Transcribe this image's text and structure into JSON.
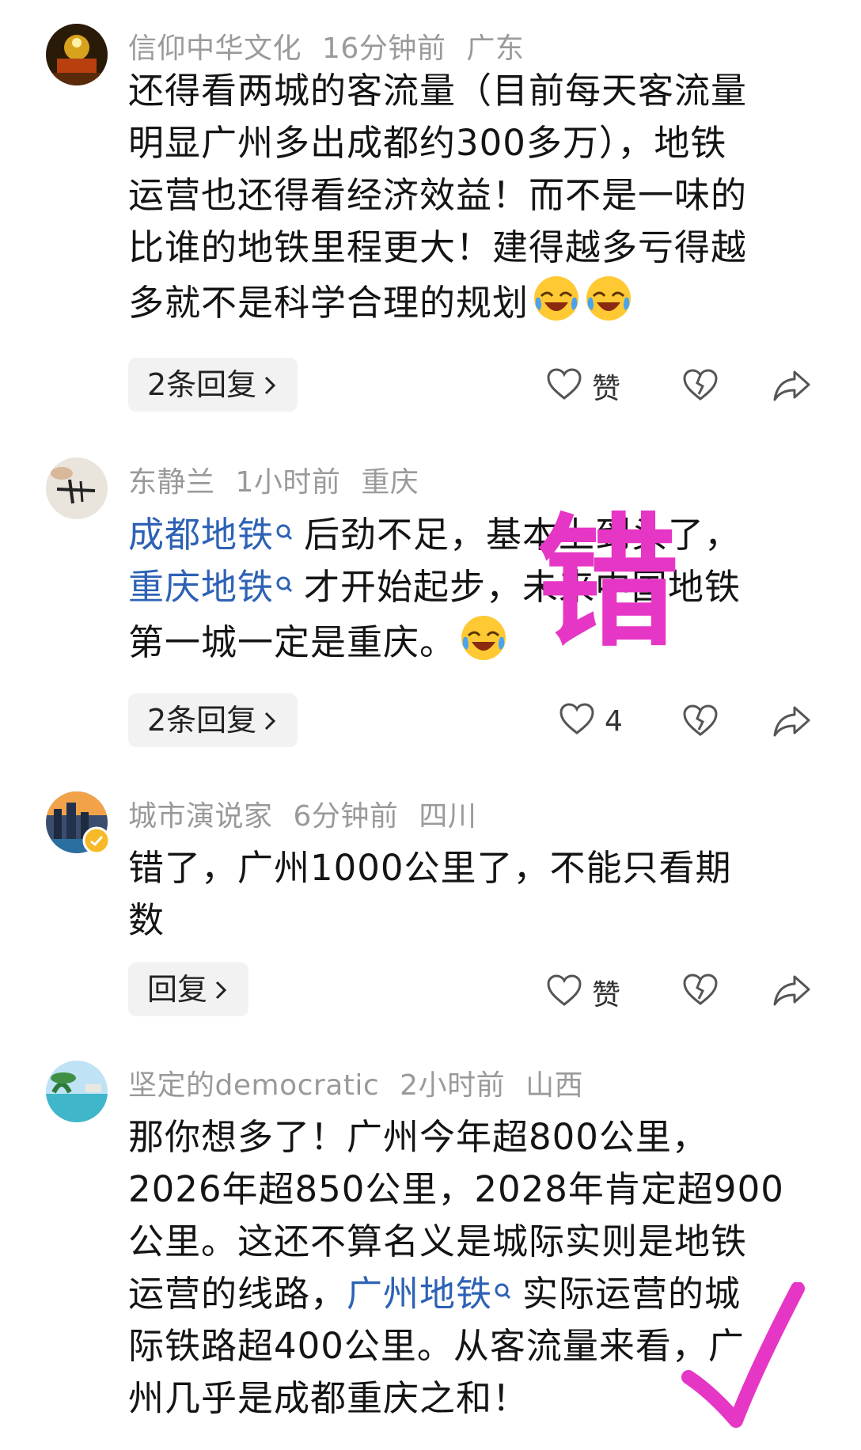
{
  "comments": [
    {
      "user": "信仰中华文化",
      "time": "16分钟前",
      "location": "广东",
      "lines": [
        [
          {
            "t": "还得看两城的客流量（目前每天客流量"
          }
        ],
        [
          {
            "t": "明显广州多出成都约300多万），地铁"
          }
        ],
        [
          {
            "t": "运营也还得看经济效益！而不是一味的"
          }
        ],
        [
          {
            "t": "比谁的地铁里程更大！建得越多亏得越"
          }
        ],
        [
          {
            "t": "多就不是科学合理的规划"
          }
        ]
      ],
      "reply_label": "2条回复",
      "like_label": "赞"
    },
    {
      "user": "东静兰",
      "time": "1小时前",
      "location": "重庆",
      "lines": [
        [
          {
            "t": "成都地铁",
            "link": true
          },
          {
            "t": "后劲不足，基本上到头了，"
          }
        ],
        [
          {
            "t": "重庆地铁",
            "link": true
          },
          {
            "t": "才开始起步，未来中国地铁"
          }
        ],
        [
          {
            "t": "第一城一定是重庆。"
          }
        ]
      ],
      "reply_label": "2条回复",
      "like_label": "4"
    },
    {
      "user": "城市演说家",
      "time": "6分钟前",
      "location": "四川",
      "lines": [
        [
          {
            "t": "错了，广州1000公里了，不能只看期"
          }
        ],
        [
          {
            "t": "数"
          }
        ]
      ],
      "reply_label": "回复",
      "like_label": "赞"
    },
    {
      "user": "坚定的democratic",
      "time": "2小时前",
      "location": "山西",
      "lines": [
        [
          {
            "t": "那你想多了！广州今年超800公里，"
          }
        ],
        [
          {
            "t": "2026年超850公里，2028年肯定超900"
          }
        ],
        [
          {
            "t": "公里。这还不算名义是城际实则是地铁"
          }
        ],
        [
          {
            "t": "运营的线路，"
          },
          {
            "t": "广州地铁",
            "link": true
          },
          {
            "t": "实际运营的城"
          }
        ],
        [
          {
            "t": "际铁路超400公里。从客流量来看，广"
          }
        ],
        [
          {
            "t": "州几乎是成都重庆之和！"
          }
        ]
      ]
    }
  ],
  "overlay": {
    "stamp_char": "错",
    "stamp_color": "#e636c6",
    "check_color": "#e636c6"
  },
  "colors": {
    "link": "#2d62b5",
    "meta": "#9a9a9a"
  },
  "icons": {
    "like": "heart-outline-icon",
    "dislike": "broken-heart-icon",
    "share": "share-arrow-icon",
    "search": "search-magnifier-icon",
    "emoji": "laugh-cry-emoji-icon"
  }
}
